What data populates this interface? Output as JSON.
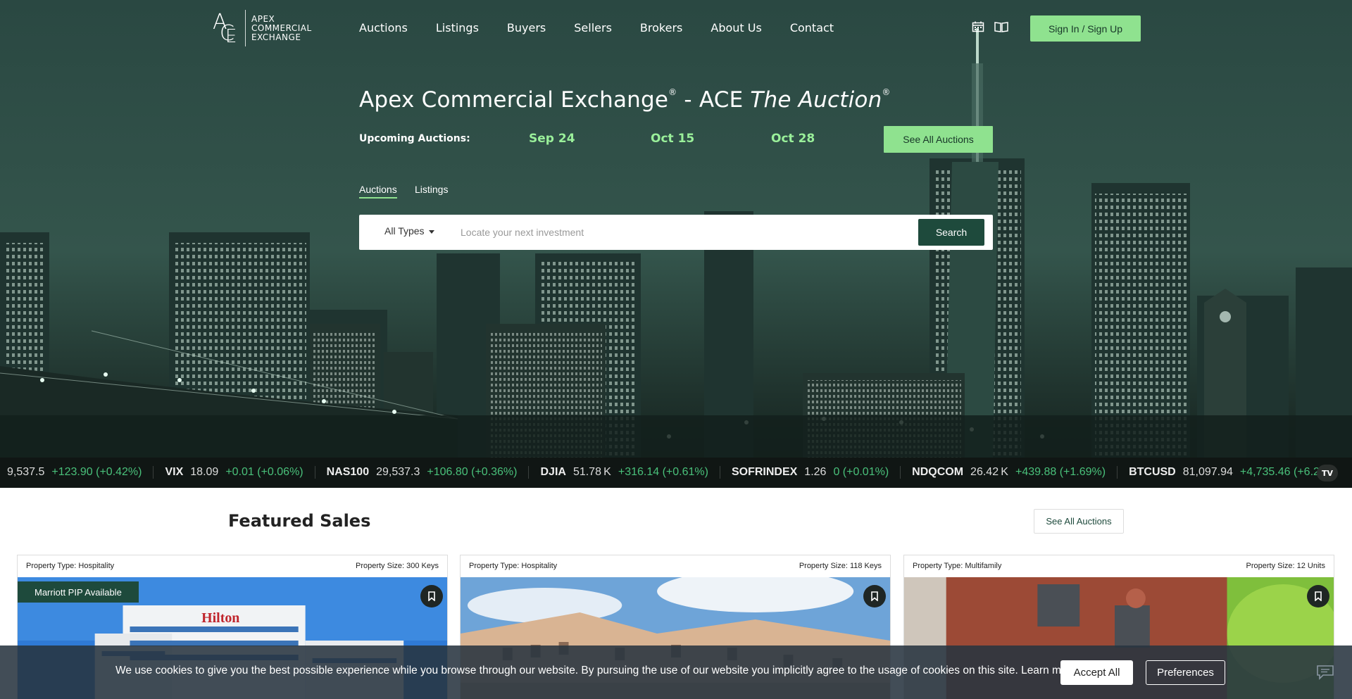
{
  "header": {
    "logo_mark": "ACE",
    "logo_lines": [
      "APEX",
      "COMMERCIAL",
      "EXCHANGE"
    ],
    "nav": [
      "Auctions",
      "Listings",
      "Buyers",
      "Sellers",
      "Brokers",
      "About Us",
      "Contact"
    ],
    "icons": [
      "calendar-icon",
      "book-icon"
    ],
    "signin_label": "Sign In / Sign Up"
  },
  "hero": {
    "title_part1": "Apex Commercial Exchange",
    "reg": "®",
    "title_sep": "- ACE",
    "title_italic": "The Auction",
    "upcoming_label": "Upcoming Auctions:",
    "dates": [
      "Sep 24",
      "Oct 15",
      "Oct 28"
    ],
    "see_all_label": "See All Auctions",
    "tabs": [
      "Auctions",
      "Listings"
    ],
    "type_select": "All Types",
    "search_placeholder": "Locate your next investment",
    "search_button": "Search"
  },
  "ticker": [
    {
      "sym": "",
      "val": "9,537.5",
      "chg": "+123.90 (+0.42%)"
    },
    {
      "sym": "VIX",
      "val": "18.09",
      "chg": "+0.01 (+0.06%)"
    },
    {
      "sym": "NAS100",
      "val": "29,537.3",
      "chg": "+106.80 (+0.36%)"
    },
    {
      "sym": "DJIA",
      "val": "51.78 K",
      "chg": "+316.14 (+0.61%)"
    },
    {
      "sym": "SOFRINDEX",
      "val": "1.26",
      "chg": "0 (+0.01%)"
    },
    {
      "sym": "NDQCOM",
      "val": "26.42 K",
      "chg": "+439.88 (+1.69%)"
    },
    {
      "sym": "BTCUSD",
      "val": "81,097.94",
      "chg": "+4,735.46 (+6.2%)"
    }
  ],
  "ticker_logo": "TV",
  "featured": {
    "title": "Featured Sales",
    "see_all_label": "See All Auctions",
    "cards": [
      {
        "type": "Property Type: Hospitality",
        "size": "Property Size: 300 Keys",
        "badge": "Marriott PIP Available",
        "sign": "Hilton"
      },
      {
        "type": "Property Type: Hospitality",
        "size": "Property Size: 118 Keys",
        "badge": ""
      },
      {
        "type": "Property Type: Multifamily",
        "size": "Property Size: 12 Units",
        "badge": ""
      }
    ]
  },
  "cookie": {
    "text": "We use cookies to give you the best possible experience while you browse through our website. By pursuing the use of our website you implicitly agree to the usage of cookies on this site. Learn more",
    "accept_label": "Accept All",
    "preferences_label": "Preferences"
  }
}
